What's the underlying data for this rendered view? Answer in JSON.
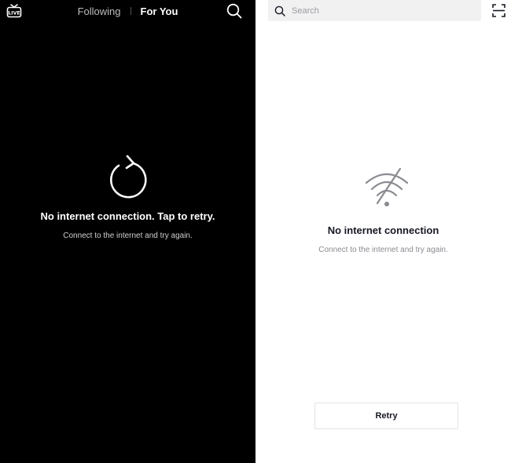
{
  "feed": {
    "live_icon": "live-tv-icon",
    "tabs": [
      {
        "label": "Following",
        "active": false
      },
      {
        "label": "For You",
        "active": true
      }
    ],
    "search_icon": "search-icon",
    "error": {
      "icon": "refresh-icon",
      "title": "No internet connection. Tap to retry.",
      "subtitle": "Connect to the internet and try again."
    }
  },
  "discover": {
    "search": {
      "placeholder": "Search",
      "value": ""
    },
    "scan_icon": "scan-icon",
    "error": {
      "icon": "wifi-off-icon",
      "title": "No internet connection",
      "subtitle": "Connect to the internet and try again."
    },
    "retry_label": "Retry"
  },
  "colors": {
    "left_bg": "#000000",
    "right_bg": "#ffffff",
    "search_bg": "#f1f1f2",
    "muted_text": "#8a8b91"
  }
}
